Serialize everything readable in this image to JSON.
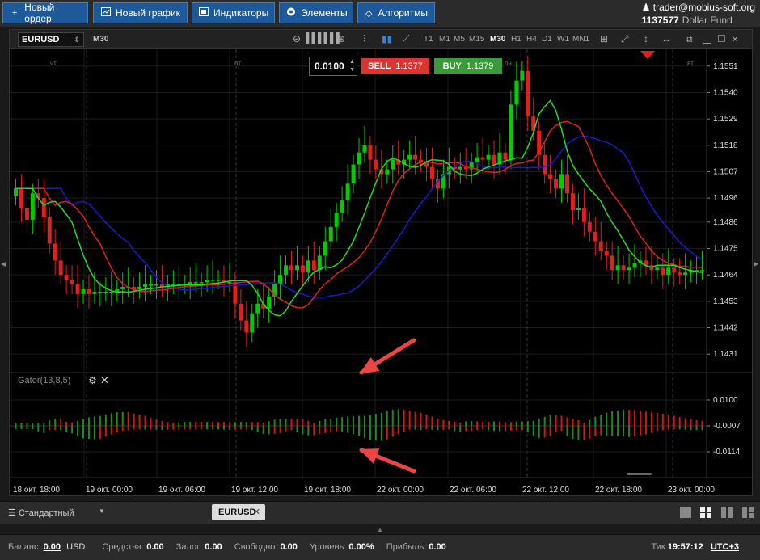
{
  "toolbar": {
    "buttons": [
      {
        "label": "Новый ордер",
        "icon": "plus-icon"
      },
      {
        "label": "Новый график",
        "icon": "chart-icon"
      },
      {
        "label": "Индикаторы",
        "icon": "indicators-icon"
      },
      {
        "label": "Элементы",
        "icon": "elements-icon"
      },
      {
        "label": "Алгоритмы",
        "icon": "algorithms-icon"
      }
    ]
  },
  "account": {
    "user": "trader@mobius-soft.org",
    "id": "1137577",
    "fund": "Dollar Fund"
  },
  "chart": {
    "symbol": "EURUSD",
    "timeframe": "M30",
    "timeframes": [
      "T1",
      "M1",
      "M5",
      "M15",
      "M30",
      "H1",
      "H4",
      "D1",
      "W1",
      "MN1"
    ],
    "active_timeframe": "M30",
    "lot": "0.0100",
    "sell_label": "SELL",
    "sell_price": "1.1377",
    "buy_label": "BUY",
    "buy_price": "1.1379",
    "day_labels": [
      "чт",
      "пт",
      "пн",
      "вт"
    ],
    "indicator_title": "Gator(13,8,5)",
    "colors": {
      "bull": "#00cc00",
      "bear": "#e02020",
      "jaw": "#1a1ad0",
      "teeth": "#e02020",
      "lips": "#22dd22",
      "arrow": "#ee4444"
    }
  },
  "chart_data": [
    {
      "type": "candlestick",
      "title": "",
      "y_ticks": [
        "1.1551",
        "1.1540",
        "1.1529",
        "1.1518",
        "1.1507",
        "1.1496",
        "1.1486",
        "1.1475",
        "1.1464",
        "1.1453",
        "1.1442",
        "1.1431"
      ],
      "ylim": [
        1.1425,
        1.1558
      ],
      "x_ticks": [
        "18 окт. 18:00",
        "19 окт. 00:00",
        "19 окт. 06:00",
        "19 окт. 12:00",
        "19 окт. 18:00",
        "22 окт. 00:00",
        "22 окт. 06:00",
        "22 окт. 12:00",
        "22 окт. 18:00",
        "23 окт. 00:00"
      ],
      "close": [
        1.15,
        1.1492,
        1.1487,
        1.1498,
        1.1496,
        1.1488,
        1.1477,
        1.147,
        1.1464,
        1.1462,
        1.146,
        1.1456,
        1.1458,
        1.1456,
        1.1457,
        1.1457,
        1.1457,
        1.1457,
        1.1458,
        1.1459,
        1.1459,
        1.1458,
        1.1459,
        1.146,
        1.146,
        1.146,
        1.1459,
        1.146,
        1.146,
        1.146,
        1.146,
        1.1461,
        1.1461,
        1.1461,
        1.1462,
        1.1462,
        1.1462,
        1.1461,
        1.1461,
        1.1452,
        1.1445,
        1.144,
        1.1448,
        1.1452,
        1.145,
        1.1455,
        1.146,
        1.1464,
        1.1468,
        1.1466,
        1.1468,
        1.1465,
        1.147,
        1.1466,
        1.1472,
        1.1478,
        1.1484,
        1.149,
        1.1495,
        1.1502,
        1.151,
        1.1515,
        1.1518,
        1.1512,
        1.1508,
        1.1506,
        1.1508,
        1.1512,
        1.151,
        1.1512,
        1.1514,
        1.1512,
        1.1511,
        1.1509,
        1.1504,
        1.15,
        1.1506,
        1.1509,
        1.1508,
        1.1509,
        1.1508,
        1.1511,
        1.1513,
        1.1512,
        1.1514,
        1.151,
        1.1515,
        1.1512,
        1.1535,
        1.1545,
        1.1549,
        1.153,
        1.1524,
        1.1514,
        1.1506,
        1.1504,
        1.15,
        1.1506,
        1.1498,
        1.1491,
        1.1492,
        1.1486,
        1.1482,
        1.1478,
        1.1474,
        1.1472,
        1.1466,
        1.1468,
        1.1466,
        1.1467,
        1.1469,
        1.147,
        1.1468,
        1.1466,
        1.1467,
        1.1464,
        1.1467,
        1.1465,
        1.1464,
        1.1465,
        1.1466,
        1.1466,
        1.1466
      ]
    },
    {
      "type": "histogram",
      "title": "Gator(13,8,5)",
      "y_ticks": [
        "0.0100",
        "-0.0007",
        "-0.0114"
      ]
    }
  ],
  "tabs": {
    "workspace": "Стандартный",
    "chart_tab": "EURUSD"
  },
  "status": {
    "balance_label": "Баланс:",
    "balance": "0.00",
    "currency": "USD",
    "funds_label": "Средства:",
    "funds": "0.00",
    "margin_label": "Залог:",
    "margin": "0.00",
    "free_label": "Свободно:",
    "free": "0.00",
    "level_label": "Уровень:",
    "level": "0.00%",
    "profit_label": "Прибыль:",
    "profit": "0.00",
    "tick_label": "Тик",
    "time": "19:57:12",
    "timezone": "UTC+3"
  }
}
